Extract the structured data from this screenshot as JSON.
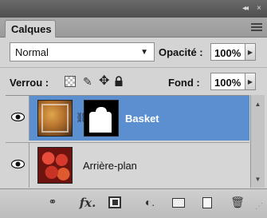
{
  "window": {
    "controls": [
      "◂◂",
      "×"
    ]
  },
  "panel": {
    "tab_label": "Calques",
    "menu_icon": "panel-menu-icon"
  },
  "blend": {
    "mode": "Normal",
    "opacity_label": "Opacité :",
    "opacity_value": "100%"
  },
  "lock": {
    "label": "Verrou :",
    "fill_label": "Fond :",
    "fill_value": "100%"
  },
  "layers": [
    {
      "name": "Basket",
      "selected": true,
      "visible": true,
      "has_mask": true
    },
    {
      "name": "Arrière-plan",
      "selected": false,
      "visible": true,
      "has_mask": false
    }
  ],
  "footer": {
    "link_glyph": "⚭",
    "fx_glyph": "fx.",
    "adjust_glyph": "◐.",
    "trash_glyph": "🗑"
  },
  "colors": {
    "selection": "#5b8fd0",
    "panel_bg": "#d4d4d4"
  }
}
